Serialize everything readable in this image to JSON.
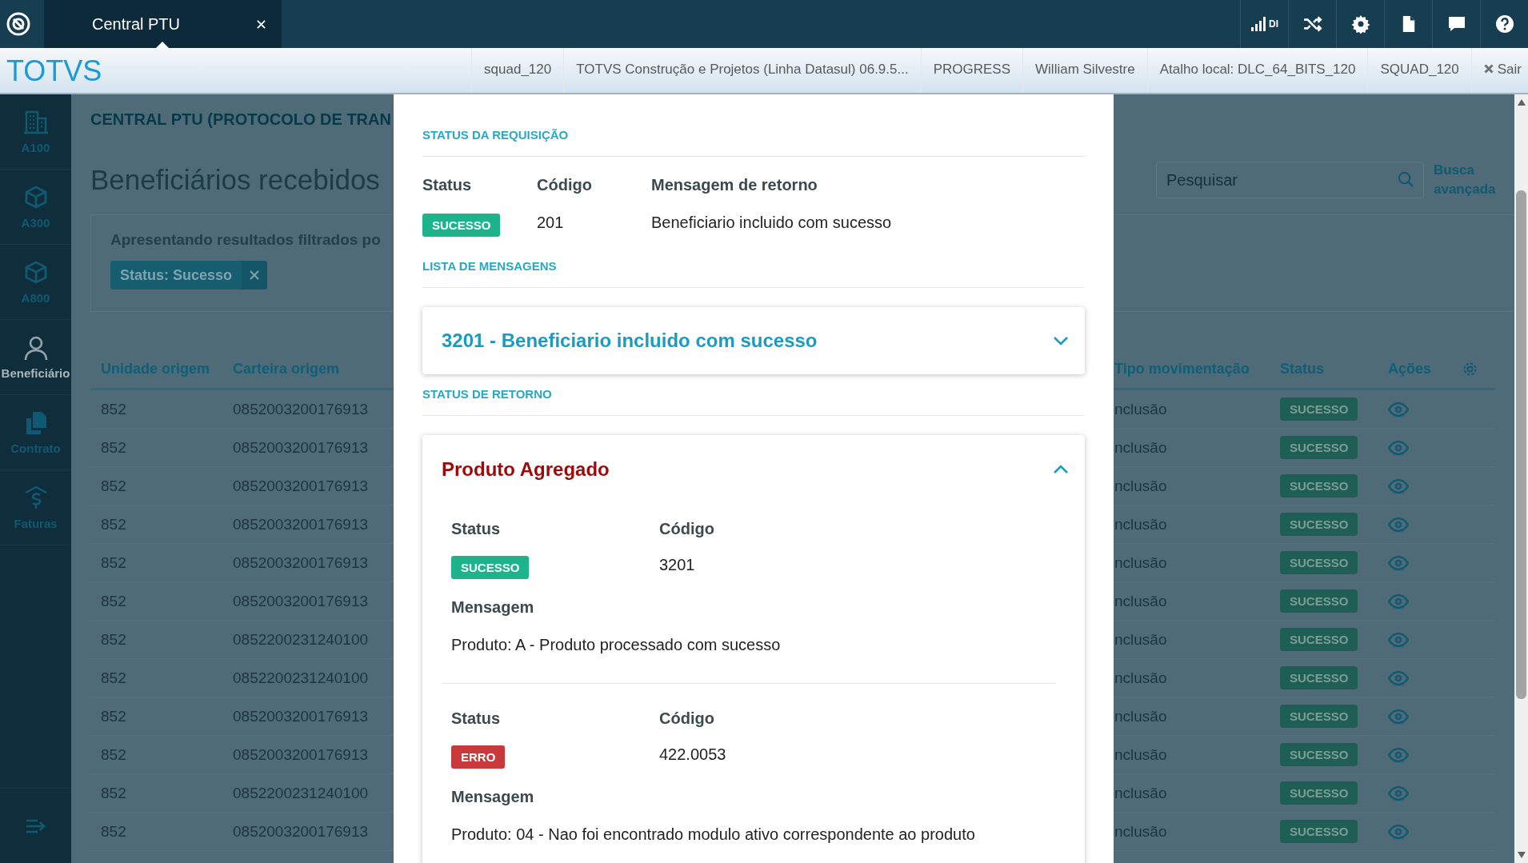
{
  "app_bar": {
    "tab": {
      "label": "Central PTU",
      "selected": true
    },
    "tools": [
      {
        "kind": "signal",
        "label": "DI"
      },
      {
        "kind": "shuffle"
      },
      {
        "kind": "gear"
      },
      {
        "kind": "document"
      },
      {
        "kind": "chat"
      },
      {
        "kind": "help"
      }
    ]
  },
  "header": {
    "brand": "TOTVS",
    "info": [
      "squad_120",
      "TOTVS Construção e Projetos (Linha Datasul) 06.9.5...",
      "PROGRESS",
      "William Silvestre",
      "Atalho local: DLC_64_BITS_120",
      "SQUAD_120"
    ],
    "exit": "Sair"
  },
  "sidebar": {
    "items": [
      {
        "kind": "building",
        "label": "A100",
        "selected": false
      },
      {
        "kind": "box",
        "label": "A300",
        "selected": false
      },
      {
        "kind": "box",
        "label": "A800",
        "selected": false
      },
      {
        "kind": "person",
        "label": "Beneficiário",
        "selected": true
      },
      {
        "kind": "copy",
        "label": "Contrato",
        "selected": false
      },
      {
        "kind": "money",
        "label": "Faturas",
        "selected": false
      }
    ]
  },
  "page": {
    "breadcrumb": "CENTRAL PTU (PROTOCOLO DE TRAN",
    "title": "Beneficiários recebidos",
    "filter_text": "Apresentando resultados filtrados po",
    "filter_chips": [
      "Status: Sucesso"
    ],
    "search": {
      "placeholder": "Pesquisar"
    },
    "advanced_search": "Busca avançada",
    "table": {
      "columns_left": [
        "Unidade origem",
        "Carteira origem"
      ],
      "columns_right": [
        "Tipo movimentação",
        "Status",
        "Ações"
      ],
      "rows": [
        {
          "unit": "852",
          "card": "0852003200176913",
          "type": "nclusão",
          "status": "SUCESSO"
        },
        {
          "unit": "852",
          "card": "0852003200176913",
          "type": "nclusão",
          "status": "SUCESSO"
        },
        {
          "unit": "852",
          "card": "0852003200176913",
          "type": "nclusão",
          "status": "SUCESSO"
        },
        {
          "unit": "852",
          "card": "0852003200176913",
          "type": "nclusão",
          "status": "SUCESSO"
        },
        {
          "unit": "852",
          "card": "0852003200176913",
          "type": "nclusão",
          "status": "SUCESSO"
        },
        {
          "unit": "852",
          "card": "0852003200176913",
          "type": "nclusão",
          "status": "SUCESSO"
        },
        {
          "unit": "852",
          "card": "0852200231240100",
          "type": "nclusão",
          "status": "SUCESSO"
        },
        {
          "unit": "852",
          "card": "0852200231240100",
          "type": "nclusão",
          "status": "SUCESSO"
        },
        {
          "unit": "852",
          "card": "0852003200176913",
          "type": "nclusão",
          "status": "SUCESSO"
        },
        {
          "unit": "852",
          "card": "0852003200176913",
          "type": "nclusão",
          "status": "SUCESSO"
        },
        {
          "unit": "852",
          "card": "0852200231240100",
          "type": "nclusão",
          "status": "SUCESSO"
        },
        {
          "unit": "852",
          "card": "0852003200176913",
          "type": "nclusão",
          "status": "SUCESSO"
        }
      ]
    }
  },
  "modal": {
    "request_section": "STATUS DA REQUISIÇÃO",
    "request_columns": [
      "Status",
      "Código",
      "Mensagem de retorno"
    ],
    "request": {
      "status": "SUCESSO",
      "kind": "success",
      "code": "201",
      "message": "Beneficiario incluido com sucesso"
    },
    "messages_section": "LISTA DE MENSAGENS",
    "messages": [
      {
        "title": "3201 - Beneficiario incluido com sucesso",
        "expanded": false
      }
    ],
    "return_section": "STATUS DE RETORNO",
    "return_panel": {
      "title": "Produto Agregado",
      "expanded": true,
      "entries": [
        {
          "status_label": "Status",
          "code_label": "Código",
          "status": "SUCESSO",
          "kind": "success",
          "code": "3201",
          "message_label": "Mensagem",
          "message": "Produto: A - Produto processado com sucesso"
        },
        {
          "status_label": "Status",
          "code_label": "Código",
          "status": "ERRO",
          "kind": "error",
          "code": "422.0053",
          "message_label": "Mensagem",
          "message": "Produto: 04 - Nao foi encontrado modulo ativo correspondente ao produto"
        }
      ]
    }
  }
}
